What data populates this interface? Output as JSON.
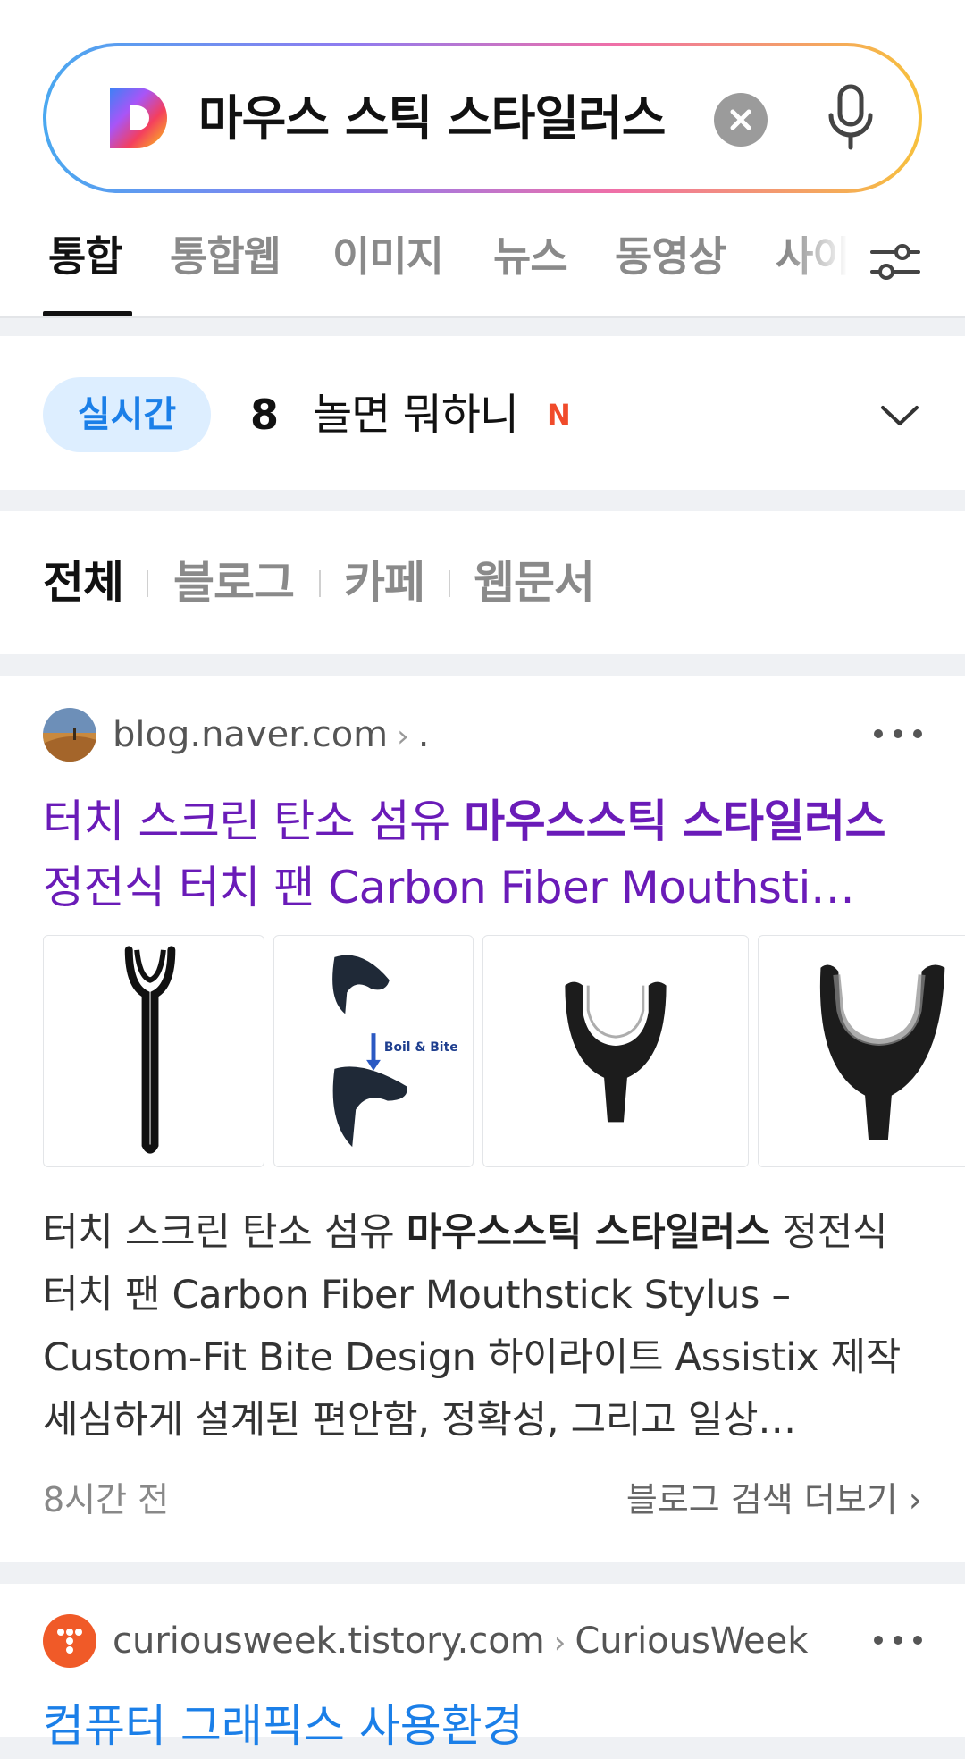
{
  "search": {
    "query": "마우스 스틱 스타일러스",
    "logo": "D",
    "clear_icon": "close-circle-icon",
    "mic_icon": "microphone-icon"
  },
  "tabs": [
    {
      "label": "통합",
      "active": true
    },
    {
      "label": "통합웹"
    },
    {
      "label": "이미지"
    },
    {
      "label": "뉴스"
    },
    {
      "label": "동영상"
    },
    {
      "label": "사이"
    }
  ],
  "realtime": {
    "badge": "실시간",
    "rank": "8",
    "keyword": "놀면 뭐하니",
    "new_badge": "N"
  },
  "filters": [
    {
      "label": "전체",
      "active": true
    },
    {
      "label": "블로그"
    },
    {
      "label": "카페"
    },
    {
      "label": "웹문서"
    }
  ],
  "results": [
    {
      "source": "blog.naver.com",
      "path": ".",
      "title_pre": "터치 스크린 탄소 섬유 ",
      "title_bold": "마우스스틱 스타일러스",
      "title_post": " 정전식 터치 팬 Carbon Fiber Mouthsti…",
      "thumb_caption": "Boil & Bite",
      "desc_pre": "터치 스크린 탄소 섬유 ",
      "desc_bold": "마우스스틱 스타일러스",
      "desc_post": " 정전식 터치 팬 Carbon Fiber Mouthstick Stylus – Custom-Fit Bite Design 하이라이트  Assistix 제작  세심하게 설계된 편안함, 정확성, 그리고 일상…",
      "time": "8시간 전",
      "more": "블로그 검색 더보기"
    },
    {
      "source": "curiousweek.tistory.com",
      "path": "CuriousWeek",
      "title": "컴퓨터 그래픽스 사용환경"
    }
  ]
}
